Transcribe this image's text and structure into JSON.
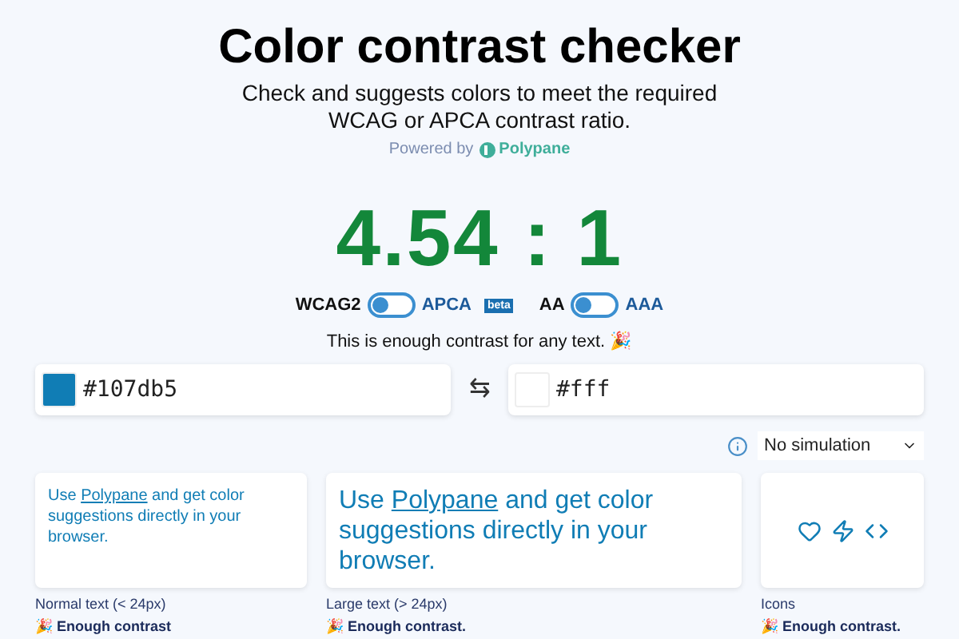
{
  "header": {
    "title": "Color contrast checker",
    "subtitle": "Check and suggests colors to meet the required WCAG or APCA contrast ratio.",
    "powered_by": "Powered by",
    "brand": "Polypane"
  },
  "ratio": "4.54 : 1",
  "toggles": [
    {
      "left": "WCAG2",
      "right": "APCA",
      "badge": "beta",
      "on": false
    },
    {
      "left": "AA",
      "right": "AAA",
      "on": false
    }
  ],
  "message": "This is enough contrast for any text. 🎉",
  "foreground": {
    "value": "#107db5",
    "color": "#107db5"
  },
  "swap": "⇆",
  "background": {
    "value": "#fff",
    "color": "#ffffff"
  },
  "simulation": {
    "value": "No simulation"
  },
  "previews": [
    {
      "kind": "small_text",
      "before": "Use ",
      "link": "Polypane",
      "after": " and get color suggestions directly in your browser.",
      "label": "Normal text (< 24px)",
      "result": "🎉 Enough contrast"
    },
    {
      "kind": "large_text",
      "before": "Use ",
      "link": "Polypane",
      "after": " and get color suggestions directly in your browser.",
      "label": "Large text (> 24px)",
      "result": "🎉 Enough contrast."
    },
    {
      "kind": "icons",
      "label": "Icons",
      "result": "🎉 Enough contrast."
    }
  ]
}
